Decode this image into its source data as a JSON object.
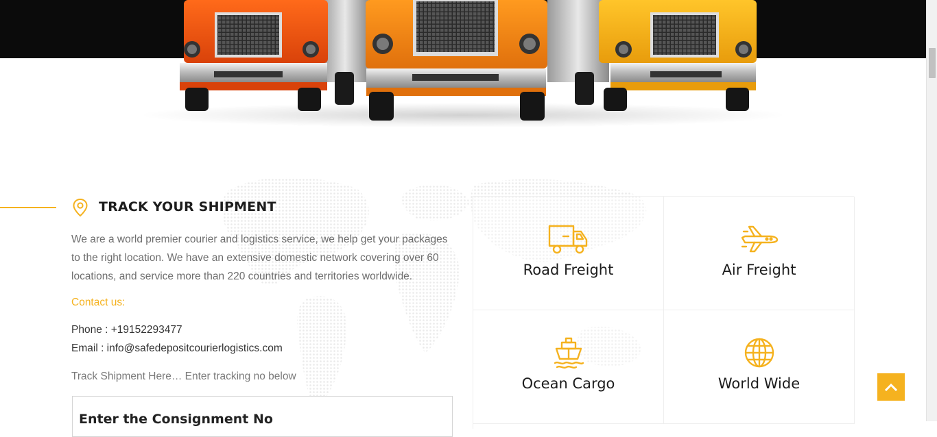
{
  "hero": {
    "image_name": "three-trucks-image"
  },
  "track": {
    "title": "TRACK YOUR SHIPMENT",
    "intro": "We are a world premier courier and logistics service, we help get your packages to the right location. We have an extensive domestic network covering over 60 locations, and service more than 220 countries and territories worldwide.",
    "contact_heading": "Contact us:",
    "phone": "Phone : +19152293477",
    "email": "Email : info@safedepositcourierlogistics.com",
    "hint": "Track Shipment Here… Enter tracking no below",
    "box_title": "Enter the Consignment No"
  },
  "services": [
    {
      "label": "Road Freight",
      "icon": "truck-icon"
    },
    {
      "label": "Air Freight",
      "icon": "airplane-icon"
    },
    {
      "label": "Ocean Cargo",
      "icon": "ship-icon"
    },
    {
      "label": "World Wide",
      "icon": "globe-icon"
    }
  ],
  "colors": {
    "accent": "#f5b21f",
    "hero_background": "#0b0b0b",
    "title": "#1d1d1d",
    "body_text": "#6d6d6d"
  }
}
